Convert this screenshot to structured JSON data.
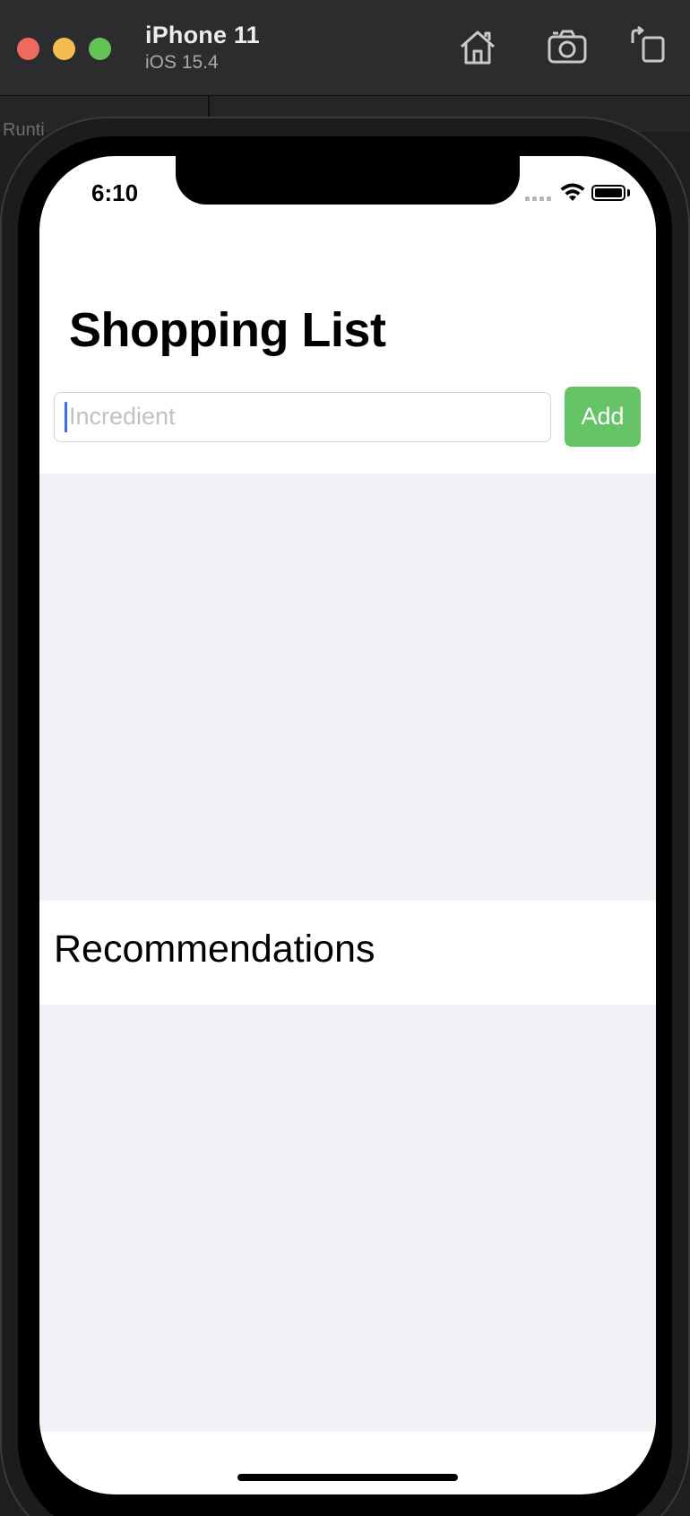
{
  "simulator": {
    "device_name": "iPhone 11",
    "os_version": "iOS 15.4",
    "subbar_text": "Runti",
    "toolbar_icons": [
      "home-icon",
      "screenshot-icon",
      "rotate-icon"
    ]
  },
  "status_bar": {
    "time": "6:10"
  },
  "app": {
    "title": "Shopping List",
    "ingredient_input": {
      "placeholder": "Incredient",
      "value": ""
    },
    "add_button_label": "Add",
    "recommendations_header": "Recommendations"
  },
  "colors": {
    "add_button": "#65c466",
    "list_background": "#f1f1f6",
    "caret": "#2f73f0"
  }
}
